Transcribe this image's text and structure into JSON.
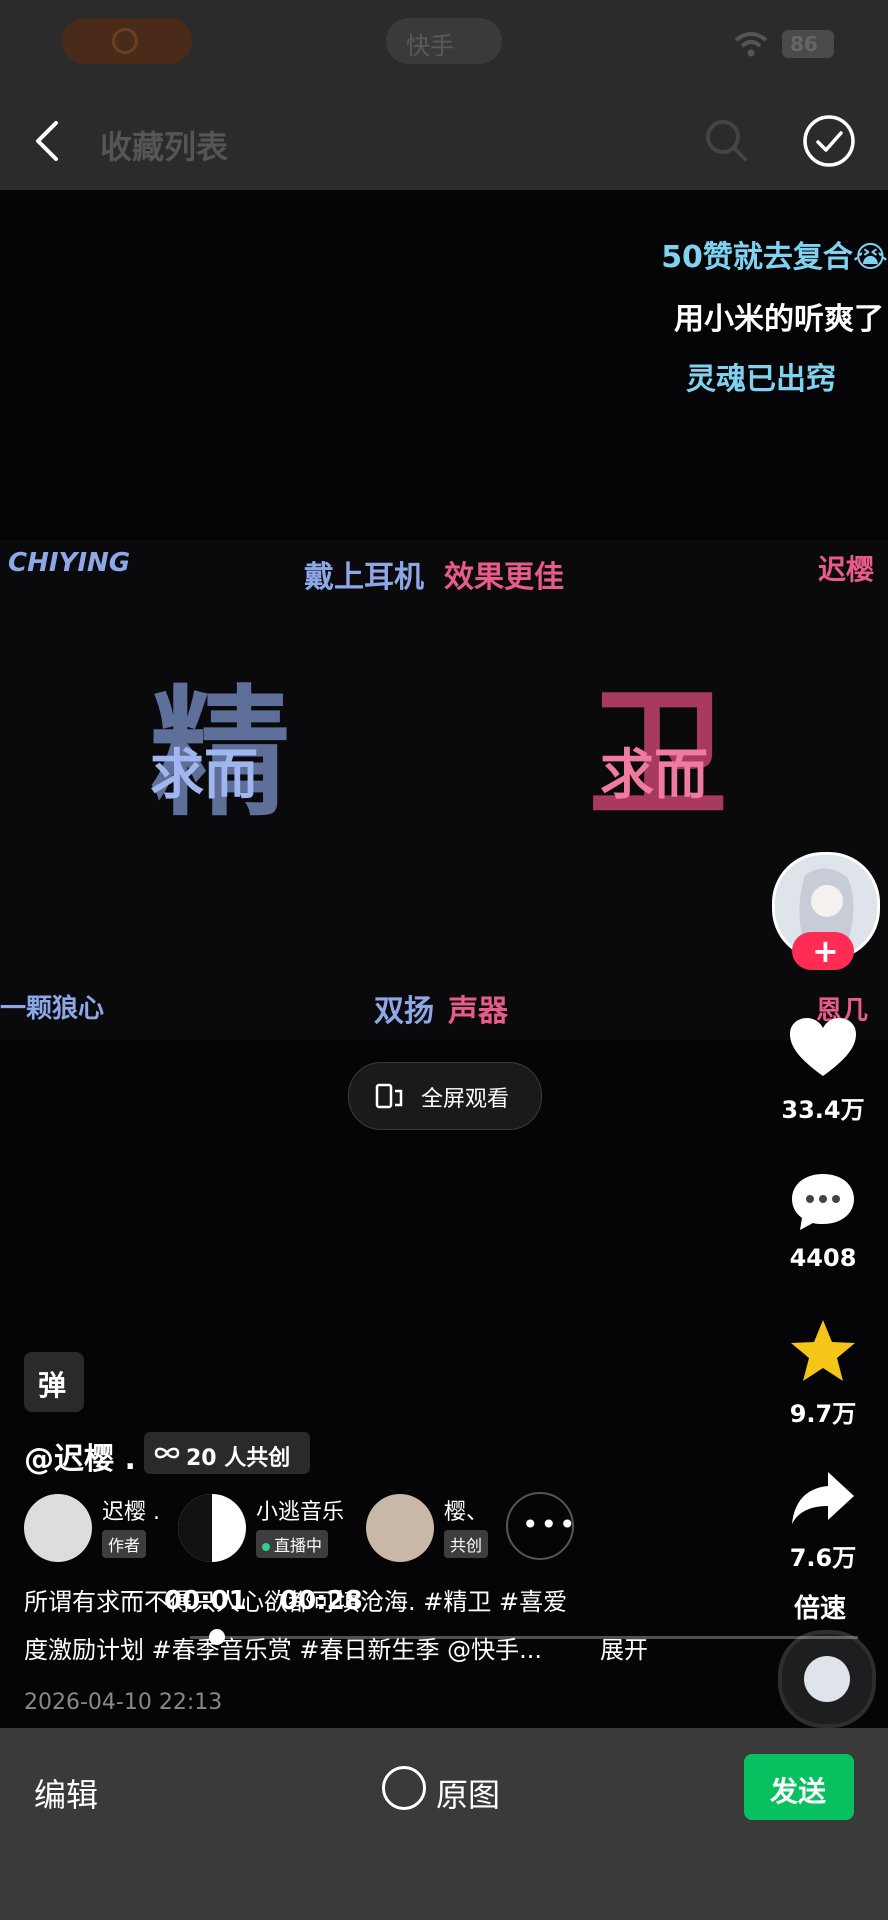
{
  "status": {
    "app_label": "快手",
    "battery": "86"
  },
  "header": {
    "title": "收藏列表"
  },
  "overlay_captions": {
    "line1": "50赞就去复合😭",
    "line2": "用小米的听爽了",
    "line3": "灵魂已出窍"
  },
  "video_text": {
    "chiying": "CHIYING",
    "headphones_a": "戴上耳机",
    "headphones_b": "效果更佳",
    "chiying_cn": "迟樱",
    "big_left_char": "精",
    "big_right_char": "卫",
    "qiu_er_left": "求而",
    "qiu_er_right": "求而",
    "left_bottom": "一颗狼心",
    "speaker_a": "双扬",
    "speaker_b": "声器",
    "right_bottom": "恩几"
  },
  "fullscreen_button": {
    "label": "全屏观看"
  },
  "side_actions": {
    "likes": "33.4万",
    "comments": "4408",
    "favorites": "9.7万",
    "shares": "7.6万",
    "speed_label": "倍速"
  },
  "post": {
    "sticker_label": "弹",
    "author_handle": "@迟樱 .",
    "cocreate_badge": "20 人共创",
    "creators": [
      {
        "name": "迟樱 .",
        "tag": "作者"
      },
      {
        "name": "小逃音乐",
        "tag": "直播中"
      },
      {
        "name": "樱、",
        "tag": "共创"
      }
    ],
    "description_line1": "所谓有求而不得只人心欲都可填沧海. #精卫 #喜爱",
    "description_line2": "度激励计划 #春季音乐赏 #春日新生季 @快手...",
    "expand_label": "展开",
    "timestamp": "2026-04-10 22:13",
    "time_current": "00:01",
    "time_total": "00:28"
  },
  "bottom_bar": {
    "edit_label": "编辑",
    "original_label": "原图",
    "send_label": "发送"
  },
  "colors": {
    "send_green": "#07c160",
    "plus_red": "#fe2c55",
    "caption_blue": "#7fd3f0",
    "pink": "#e85b8a",
    "lavender": "#8ea7e6"
  },
  "progress_fraction": 0.04
}
